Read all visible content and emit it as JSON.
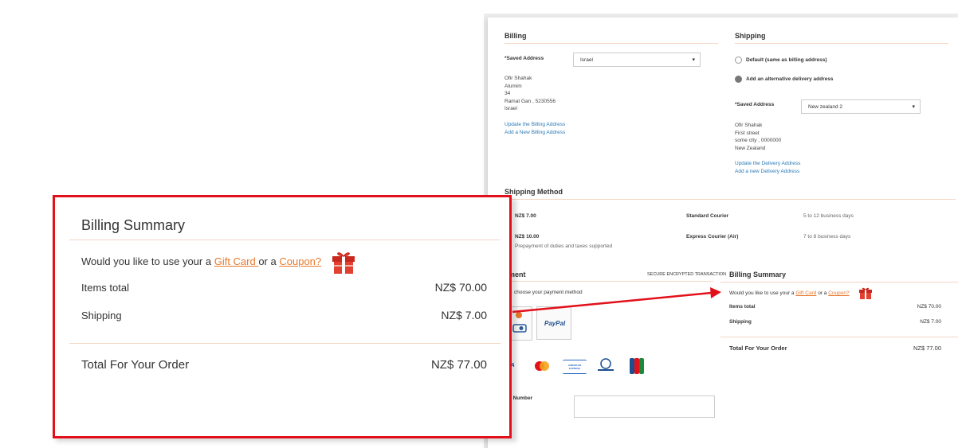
{
  "billing": {
    "title": "Billing",
    "saved_address_label": "Saved Address",
    "saved_address_value": "Israel",
    "address_lines": [
      "Ofir Shahak",
      "Alumim",
      "34",
      "Ramat Gan , 5230556",
      "Israel"
    ],
    "links": [
      "Update the Billing Address",
      "Add a New Billing Address"
    ]
  },
  "shipping": {
    "title": "Shipping",
    "option_default": "Default (same as billing address)",
    "option_alternative": "Add an alternative delivery address",
    "saved_address_label": "Saved Address",
    "saved_address_value": "New zealand 2",
    "address_lines": [
      "Ofir Shahak",
      "First street",
      "some city , 0000000",
      "New Zealand"
    ],
    "links": [
      "Update the Delivery Address",
      "Add a new Delivery Address"
    ]
  },
  "shipping_method": {
    "title": "Shipping Method",
    "methods": [
      {
        "price": "NZ$ 7.00",
        "name": "Standard Courier",
        "time": "5 to 12 business days",
        "note": ""
      },
      {
        "price": "NZ$ 10.00",
        "name": "Express Courier (Air)",
        "time": "7 to 8 business days",
        "note": "Prepayment of duties and taxes supported"
      }
    ]
  },
  "payment": {
    "title": "yment",
    "secure_label": "SECURE ENCRYPTED TRANSACTION",
    "instruction": "choose your payment method",
    "paypal_label": "PayPal",
    "card_number_label": "l Number",
    "cards": [
      "visa",
      "mastercard",
      "american-express",
      "diners-club",
      "jcb"
    ],
    "visa_text": "SA",
    "amex_text": "AMERICAN EXPRESS"
  },
  "summary_small": {
    "title": "Billing Summary",
    "question_prefix": "Would you like to use your a",
    "gift_card": "Gift Card",
    "question_mid": "or a",
    "coupon": "Coupon?",
    "items_label": "Items total",
    "items_value": "NZ$ 70.00",
    "shipping_label": "Shipping",
    "shipping_value": "NZ$ 7.00",
    "total_label": "Total For Your Order",
    "total_value": "NZ$ 77.00"
  },
  "summary_zoom": {
    "title": "Billing Summary",
    "question_prefix": "Would you like to use your a",
    "gift_card": "Gift Card ",
    "question_mid": "or a",
    "coupon": "Coupon?",
    "items_label": "Items total",
    "items_value": "NZ$ 70.00",
    "shipping_label": "Shipping",
    "shipping_value": "NZ$ 7.00",
    "total_label": "Total For Your Order",
    "total_value": "NZ$ 77.00"
  },
  "colors": {
    "highlight_border": "#e2101a",
    "arrow": "#e2101a",
    "link_blue": "#2a7ab8",
    "link_orange": "#e7782b",
    "divider": "#f3d6c5"
  }
}
